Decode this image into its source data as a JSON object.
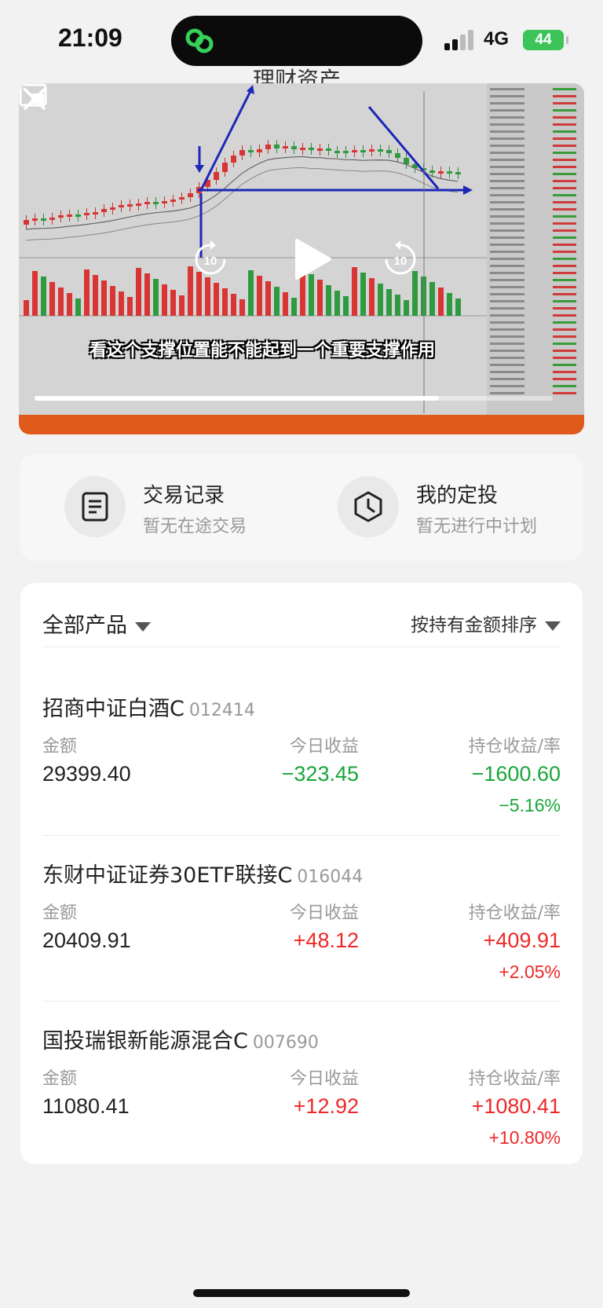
{
  "status_bar": {
    "time": "21:09",
    "network": "4G",
    "battery": "44"
  },
  "page": {
    "title": "理财资产"
  },
  "video": {
    "subtitle": "看这个支撑位置能不能起到一个重要支撑作用",
    "rewind_seconds": "10",
    "forward_seconds": "10",
    "progress": 0.78
  },
  "quick_actions": [
    {
      "title": "交易记录",
      "subtitle": "暂无在途交易",
      "icon": "document-icon"
    },
    {
      "title": "我的定投",
      "subtitle": "暂无进行中计划",
      "icon": "clock-icon"
    }
  ],
  "holdings": {
    "filter_label": "全部产品",
    "sort_label": "按持有金额排序",
    "column_labels": {
      "amount": "金额",
      "today": "今日收益",
      "position": "持仓收益/率"
    },
    "funds": [
      {
        "name": "招商中证白酒C",
        "code": "012414",
        "amount": "29399.40",
        "today": "−323.45",
        "profit": "−1600.60",
        "rate": "−5.16%",
        "trend": "neg"
      },
      {
        "name": "东财中证证券30ETF联接C",
        "code": "016044",
        "amount": "20409.91",
        "today": "+48.12",
        "profit": "+409.91",
        "rate": "+2.05%",
        "trend": "pos"
      },
      {
        "name": "国投瑞银新能源混合C",
        "code": "007690",
        "amount": "11080.41",
        "today": "+12.92",
        "profit": "+1080.41",
        "rate": "+10.80%",
        "trend": "pos"
      }
    ]
  },
  "colors": {
    "gain": "#ee2828",
    "loss": "#18a63a",
    "brand": "#e05a1c"
  }
}
